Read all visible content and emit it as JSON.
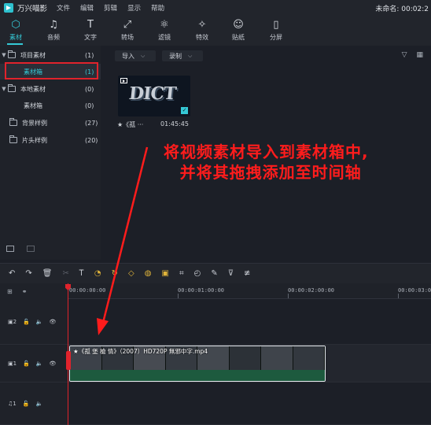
{
  "app": {
    "name": "万兴喵影",
    "document_title": "未命名: 00:02:2"
  },
  "menu": [
    "文件",
    "编辑",
    "剪辑",
    "显示",
    "帮助"
  ],
  "tabs": [
    {
      "label": "素材",
      "icon": "media-icon",
      "glyph": "⬡",
      "active": true
    },
    {
      "label": "音频",
      "icon": "music-note-icon",
      "glyph": "♫"
    },
    {
      "label": "文字",
      "icon": "text-icon",
      "glyph": "T"
    },
    {
      "label": "转场",
      "icon": "transition-icon",
      "glyph": "⤢"
    },
    {
      "label": "滤镜",
      "icon": "filter-icon",
      "glyph": "⚛"
    },
    {
      "label": "特效",
      "icon": "effects-icon",
      "glyph": "✧"
    },
    {
      "label": "贴纸",
      "icon": "sticker-icon",
      "glyph": "☺"
    },
    {
      "label": "分屏",
      "icon": "split-screen-icon",
      "glyph": "▯"
    }
  ],
  "tree": [
    {
      "label": "项目素材",
      "count": "(1)",
      "expanded": true
    },
    {
      "label": "素材箱",
      "count": "(1)",
      "selected": true,
      "indent": true
    },
    {
      "label": "本地素材",
      "count": "(0)",
      "expanded": true
    },
    {
      "label": "素材箱",
      "count": "(0)",
      "indent": true
    },
    {
      "label": "背景样例",
      "count": "(27)"
    },
    {
      "label": "片头样例",
      "count": "(20)"
    }
  ],
  "media": {
    "import_label": "导入",
    "record_label": "录制",
    "items": [
      {
        "name": "★《孤 ···",
        "duration": "01:45:45",
        "thumb_text": "DICT"
      }
    ]
  },
  "annotation": {
    "line1": "将视频素材导入到素材箱中,",
    "line2": "并将其拖拽添加至时间轴"
  },
  "timeline": {
    "ticks": [
      "00:00:00:00",
      "00:00:01:00:00",
      "00:00:02:00:00",
      "00:00:03:00:00"
    ],
    "tracks": [
      {
        "id": "2",
        "type": "video"
      },
      {
        "id": "1",
        "type": "video"
      },
      {
        "id": "1",
        "type": "audio"
      }
    ],
    "clip_title": "★《孤 堡 槍 情》（2007）HD720P 無邪中字.mp4"
  },
  "colors": {
    "accent": "#35c9d6",
    "highlight_red": "#e0232c",
    "annotation_red": "#ff1c1c"
  }
}
